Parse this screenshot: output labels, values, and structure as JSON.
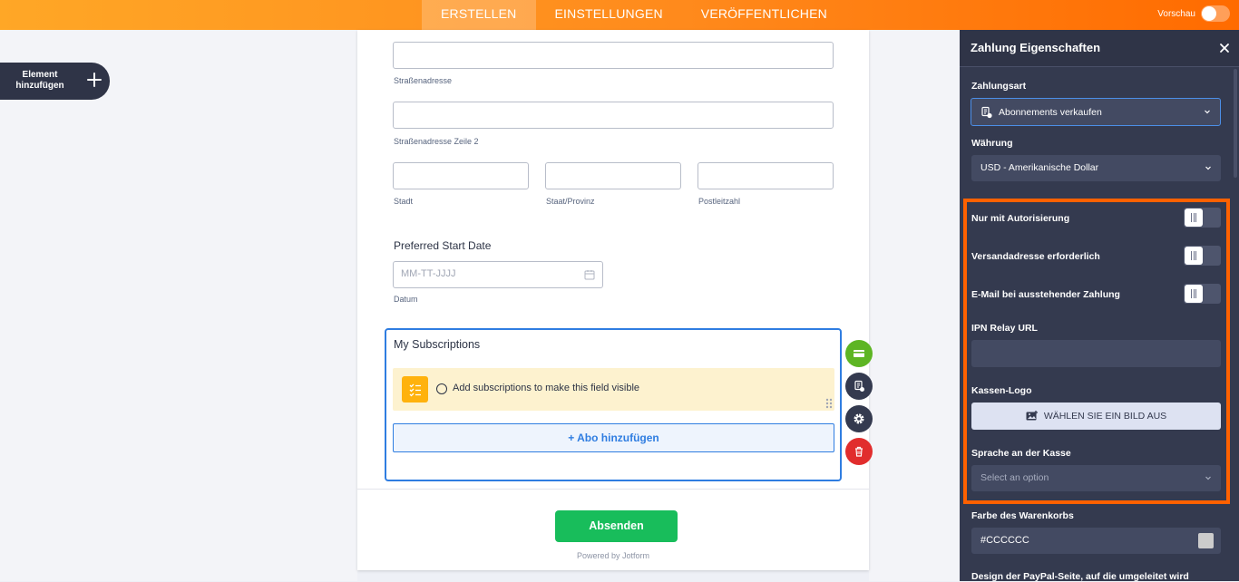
{
  "topbar": {
    "tabs": [
      "ERSTELLEN",
      "EINSTELLUNGEN",
      "VERÖFFENTLICHEN"
    ],
    "preview_label": "Vorschau"
  },
  "sidebar": {
    "add_element_label": "Element hinzufügen"
  },
  "form": {
    "address": {
      "street_label": "Straßenadresse",
      "street2_label": "Straßenadresse Zeile 2",
      "city_label": "Stadt",
      "state_label": "Staat/Provinz",
      "zip_label": "Postleitzahl"
    },
    "date": {
      "question": "Preferred Start Date",
      "placeholder": "MM-TT-JJJJ",
      "sublabel": "Datum"
    },
    "subscriptions": {
      "title": "My Subscriptions",
      "notice": "Add subscriptions to make this field visible",
      "add_button": "+ Abo hinzufügen"
    },
    "submit_label": "Absenden",
    "powered_by": "Powered by Jotform"
  },
  "panel": {
    "title": "Zahlung Eigenschaften",
    "payment_type_label": "Zahlungsart",
    "payment_type_value": "Abonnements verkaufen",
    "currency_label": "Währung",
    "currency_value": "USD - Amerikanische Dollar",
    "toggles": [
      {
        "label": "Nur mit Autorisierung",
        "on": false
      },
      {
        "label": "Versandadresse erforderlich",
        "on": false
      },
      {
        "label": "E-Mail bei ausstehender Zahlung",
        "on": false
      }
    ],
    "ipn_label": "IPN Relay URL",
    "ipn_value": "",
    "logo_label": "Kassen-Logo",
    "logo_button": "WÄHLEN SIE EIN BILD AUS",
    "language_label": "Sprache an der Kasse",
    "language_placeholder": "Select an option",
    "cart_color_label": "Farbe des Warenkorbs",
    "cart_color_value": "#CCCCCC",
    "paypal_label": "Design der PayPal-Seite, auf die umgeleitet wird"
  },
  "colors": {
    "accent_orange": "#ff6100",
    "submit_green": "#18bd5b",
    "focus_blue": "#2f7de1",
    "panel_bg": "#343a4f"
  }
}
